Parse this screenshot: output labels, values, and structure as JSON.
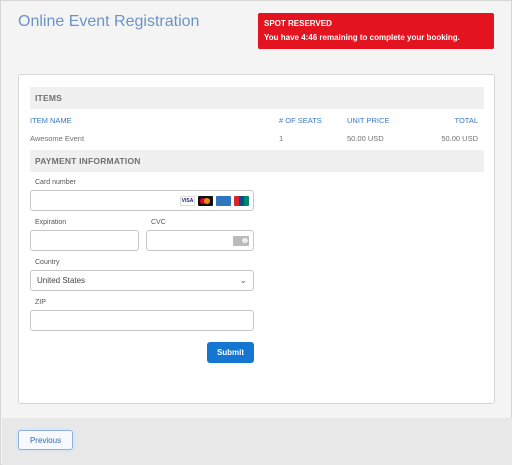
{
  "page": {
    "title": "Online Event Registration"
  },
  "alert": {
    "title": "SPOT RESERVED",
    "text": "You have 4:46 remaining to complete your booking."
  },
  "items": {
    "heading": "ITEMS",
    "columns": [
      "ITEM NAME",
      "# OF SEATS",
      "UNIT PRICE",
      "TOTAL"
    ],
    "rows": [
      {
        "name": "Awesome Event",
        "seats": "1",
        "unit_price": "50.00 USD",
        "total": "50.00 USD"
      }
    ]
  },
  "payment": {
    "heading": "PAYMENT INFORMATION",
    "card_number_label": "Card number",
    "card_number_value": "",
    "card_brands": [
      "visa",
      "mastercard",
      "amex",
      "unionpay"
    ],
    "card_brand_text": {
      "visa": "VISA"
    },
    "expiration_label": "Expiration",
    "expiration_value": "",
    "cvc_label": "CVC",
    "cvc_value": "",
    "country_label": "Country",
    "country_value": "United States",
    "zip_label": "ZIP",
    "zip_value": "",
    "submit_label": "Submit"
  },
  "footer": {
    "previous_label": "Previous"
  },
  "colors": {
    "alert_bg": "#e3141f",
    "accent": "#1576d1",
    "title": "#6b93c6",
    "link_text": "#3a79c4"
  }
}
